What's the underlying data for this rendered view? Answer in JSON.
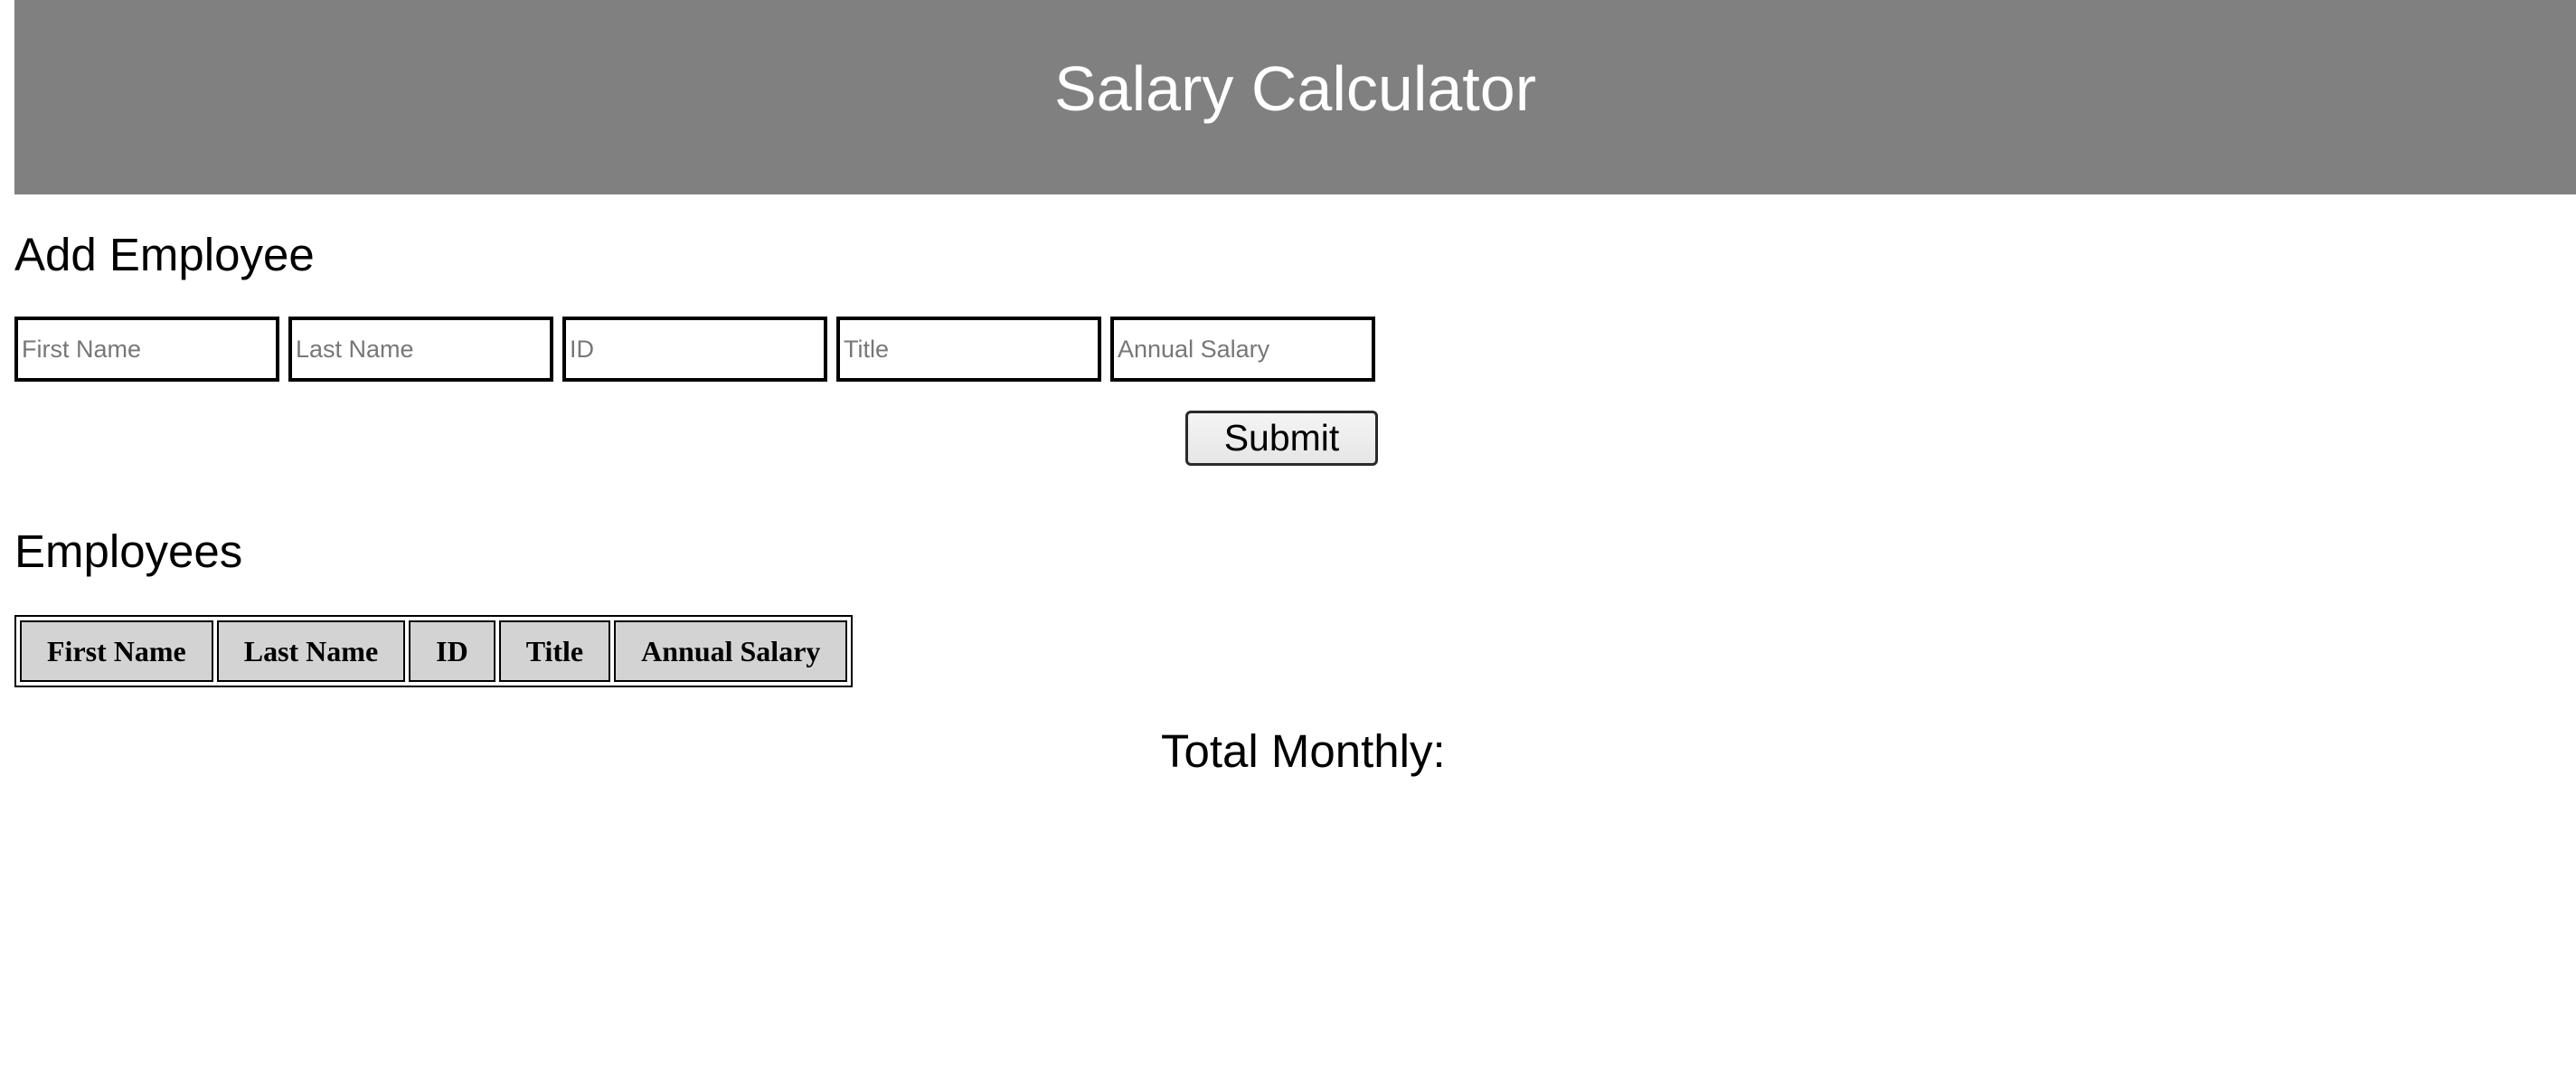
{
  "header": {
    "title": "Salary Calculator",
    "background_color": "#808080",
    "title_color": "#ffffff"
  },
  "add_employee": {
    "title": "Add Employee",
    "fields": [
      {
        "placeholder": "First Name",
        "value": ""
      },
      {
        "placeholder": "Last Name",
        "value": ""
      },
      {
        "placeholder": "ID",
        "value": ""
      },
      {
        "placeholder": "Title",
        "value": ""
      },
      {
        "placeholder": "Annual Salary",
        "value": ""
      }
    ],
    "submit_label": "Submit"
  },
  "employees": {
    "title": "Employees",
    "columns": [
      "First Name",
      "Last Name",
      "ID",
      "Title",
      "Annual Salary"
    ],
    "rows": [],
    "header_cell_color": "#d3d3d3"
  },
  "total": {
    "label": "Total Monthly:"
  }
}
